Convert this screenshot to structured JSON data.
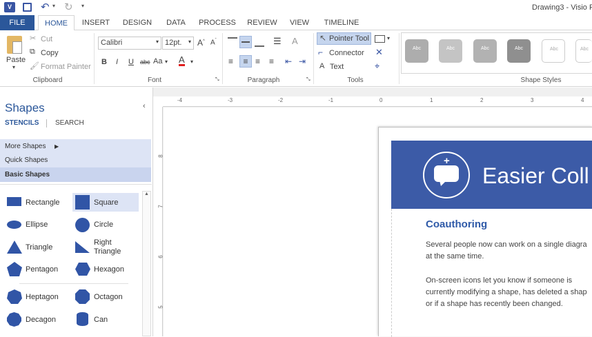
{
  "titlebar": {
    "window_title": "Drawing3 - Visio Pr",
    "quick_access_icons": [
      "visio-logo",
      "save-icon",
      "undo-icon",
      "redo-icon",
      "customize-icon"
    ]
  },
  "tabs": [
    {
      "label": "FILE"
    },
    {
      "label": "HOME"
    },
    {
      "label": "INSERT"
    },
    {
      "label": "DESIGN"
    },
    {
      "label": "DATA"
    },
    {
      "label": "PROCESS"
    },
    {
      "label": "REVIEW"
    },
    {
      "label": "VIEW"
    },
    {
      "label": "TIMELINE"
    }
  ],
  "clipboard": {
    "paste": "Paste",
    "cut": "Cut",
    "copy": "Copy",
    "format_painter": "Format Painter",
    "group": "Clipboard"
  },
  "font": {
    "family": "Calibri",
    "size": "12pt.",
    "group": "Font",
    "bold": "B",
    "italic": "I",
    "underline": "U",
    "strike": "abc",
    "case": "Aa"
  },
  "paragraph": {
    "group": "Paragraph"
  },
  "tools": {
    "pointer": "Pointer Tool",
    "connector": "Connector",
    "text": "Text",
    "group": "Tools"
  },
  "shape_styles": {
    "group": "Shape Styles",
    "swatch_label": "Abc"
  },
  "shapes_panel": {
    "title": "Shapes",
    "stencils": "STENCILS",
    "search": "SEARCH",
    "more_shapes": "More Shapes",
    "quick_shapes": "Quick Shapes",
    "basic_shapes": "Basic Shapes",
    "items": [
      "Rectangle",
      "Square",
      "Ellipse",
      "Circle",
      "Triangle",
      "Right Triangle",
      "Pentagon",
      "Hexagon",
      "Heptagon",
      "Octagon",
      "Decagon",
      "Can"
    ]
  },
  "ruler": {
    "h_ticks": [
      "-4",
      "-3",
      "-2",
      "-1",
      "0",
      "1",
      "2",
      "3",
      "4"
    ],
    "v_ticks": [
      "8",
      "7",
      "6",
      "5"
    ]
  },
  "page": {
    "banner_title": "Easier Coll",
    "heading": "Coauthoring",
    "para1_line1": "Several people now can work on a single diagra",
    "para1_line2": "at the same time.",
    "para2_line1": "On-screen icons let you know if someone is",
    "para2_line2": "currently modifying a shape, has deleted a shap",
    "para2_line3": "or if a shape has recently been changed."
  },
  "colors": {
    "accent": "#2b579a",
    "banner": "#3c5ba7",
    "shape_fill": "#3155a6",
    "panel_selected": "#dde4f5"
  }
}
